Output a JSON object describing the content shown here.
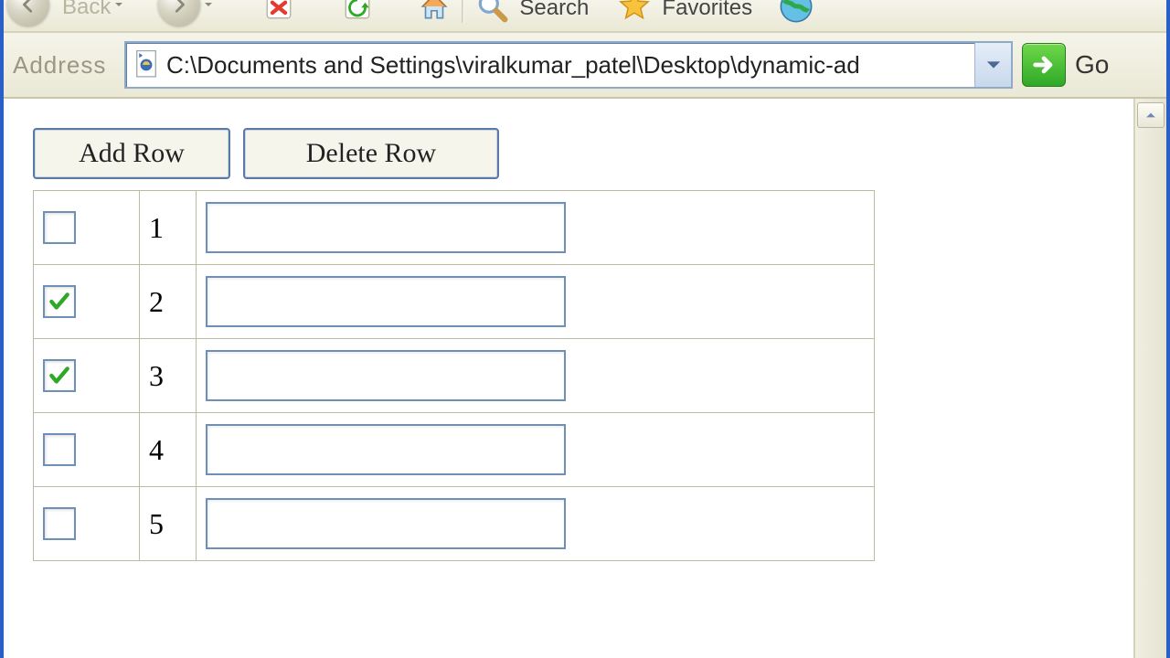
{
  "toolbar": {
    "back_label": "Back",
    "search_label": "Search",
    "favorites_label": "Favorites"
  },
  "addressbar": {
    "label": "Address",
    "url": "C:\\Documents and Settings\\viralkumar_patel\\Desktop\\dynamic-ad",
    "go_label": "Go"
  },
  "page": {
    "add_row_label": "Add Row",
    "delete_row_label": "Delete Row",
    "rows": [
      {
        "checked": false,
        "number": "1",
        "value": ""
      },
      {
        "checked": true,
        "number": "2",
        "value": ""
      },
      {
        "checked": true,
        "number": "3",
        "value": ""
      },
      {
        "checked": false,
        "number": "4",
        "value": ""
      },
      {
        "checked": false,
        "number": "5",
        "value": ""
      }
    ]
  }
}
